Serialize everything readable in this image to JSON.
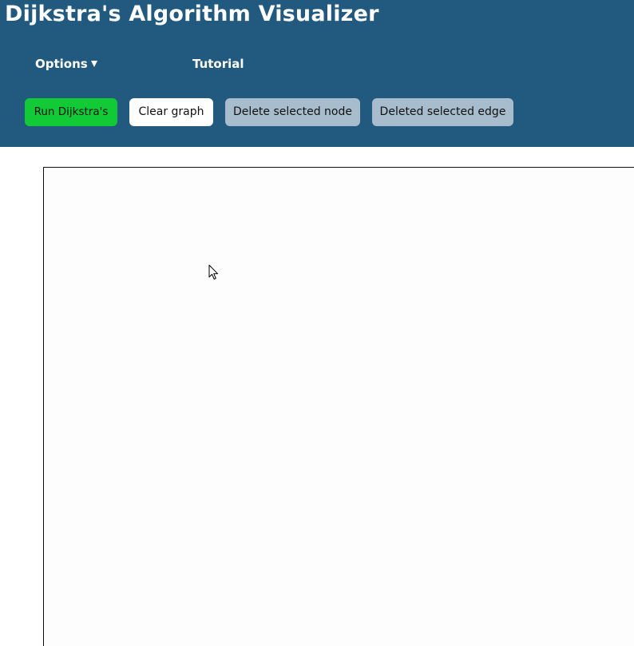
{
  "header": {
    "title": "Dijkstra's Algorithm Visualizer",
    "background_color": "#225a7f"
  },
  "nav": {
    "options_label": "Options",
    "options_icon": "caret-down-icon",
    "tutorial_label": "Tutorial"
  },
  "toolbar": {
    "run_label": "Run Dijkstra's",
    "run_color": "#12c936",
    "clear_label": "Clear graph",
    "delete_node_label": "Delete selected node",
    "delete_edge_label": "Deleted selected edge",
    "disabled_color": "#a7bccc"
  },
  "canvas": {
    "cursor_icon": "mouse-pointer-icon"
  }
}
